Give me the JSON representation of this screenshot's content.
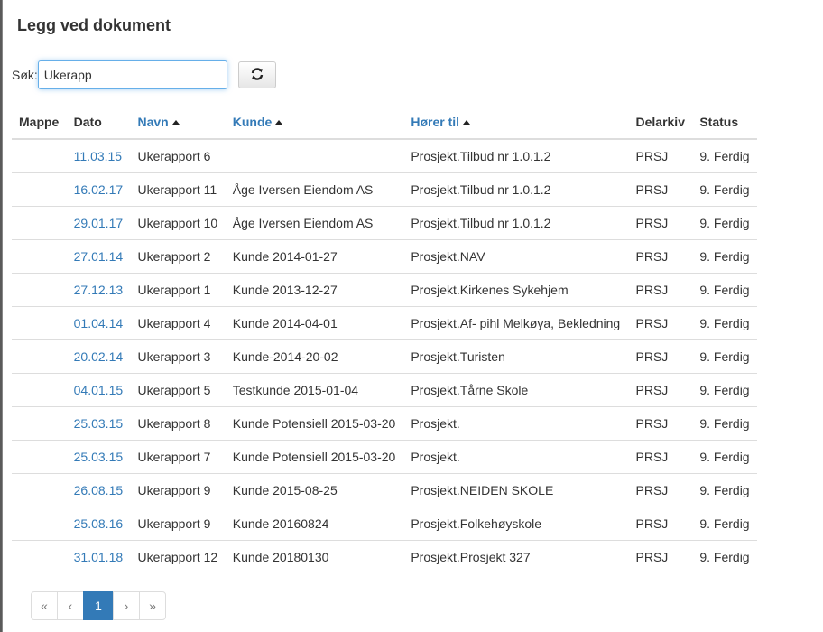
{
  "modal": {
    "title": "Legg ved dokument"
  },
  "search": {
    "label": "Søk:",
    "value": "Ukerapp"
  },
  "refresh": {
    "icon": "refresh-icon"
  },
  "table": {
    "headers": {
      "mappe": "Mappe",
      "dato": "Dato",
      "navn": "Navn",
      "kunde": "Kunde",
      "horer_til": "Hører til",
      "delarkiv": "Delarkiv",
      "status": "Status"
    },
    "rows": [
      {
        "dato": "11.03.15",
        "navn": "Ukerapport 6",
        "kunde": "",
        "horer_til": "Prosjekt.Tilbud nr 1.0.1.2",
        "delarkiv": "PRSJ",
        "status": "9. Ferdig"
      },
      {
        "dato": "16.02.17",
        "navn": "Ukerapport 11",
        "kunde": "Åge Iversen Eiendom AS",
        "horer_til": "Prosjekt.Tilbud nr 1.0.1.2",
        "delarkiv": "PRSJ",
        "status": "9. Ferdig"
      },
      {
        "dato": "29.01.17",
        "navn": "Ukerapport 10",
        "kunde": "Åge Iversen Eiendom AS",
        "horer_til": "Prosjekt.Tilbud nr 1.0.1.2",
        "delarkiv": "PRSJ",
        "status": "9. Ferdig"
      },
      {
        "dato": "27.01.14",
        "navn": "Ukerapport 2",
        "kunde": "Kunde 2014-01-27",
        "horer_til": "Prosjekt.NAV",
        "delarkiv": "PRSJ",
        "status": "9. Ferdig"
      },
      {
        "dato": "27.12.13",
        "navn": "Ukerapport 1",
        "kunde": "Kunde 2013-12-27",
        "horer_til": "Prosjekt.Kirkenes Sykehjem",
        "delarkiv": "PRSJ",
        "status": "9. Ferdig"
      },
      {
        "dato": "01.04.14",
        "navn": "Ukerapport 4",
        "kunde": "Kunde 2014-04-01",
        "horer_til": "Prosjekt.Af- pihl Melkøya, Bekledning",
        "delarkiv": "PRSJ",
        "status": "9. Ferdig"
      },
      {
        "dato": "20.02.14",
        "navn": "Ukerapport 3",
        "kunde": "Kunde-2014-20-02",
        "horer_til": "Prosjekt.Turisten",
        "delarkiv": "PRSJ",
        "status": "9. Ferdig"
      },
      {
        "dato": "04.01.15",
        "navn": "Ukerapport 5",
        "kunde": "Testkunde 2015-01-04",
        "horer_til": "Prosjekt.Tårne Skole",
        "delarkiv": "PRSJ",
        "status": "9. Ferdig"
      },
      {
        "dato": "25.03.15",
        "navn": "Ukerapport 8",
        "kunde": "Kunde Potensiell 2015-03-20",
        "horer_til": "Prosjekt.",
        "delarkiv": "PRSJ",
        "status": "9. Ferdig"
      },
      {
        "dato": "25.03.15",
        "navn": "Ukerapport 7",
        "kunde": "Kunde Potensiell 2015-03-20",
        "horer_til": "Prosjekt.",
        "delarkiv": "PRSJ",
        "status": "9. Ferdig"
      },
      {
        "dato": "26.08.15",
        "navn": "Ukerapport 9",
        "kunde": "Kunde 2015-08-25",
        "horer_til": "Prosjekt.NEIDEN SKOLE",
        "delarkiv": "PRSJ",
        "status": "9. Ferdig"
      },
      {
        "dato": "25.08.16",
        "navn": "Ukerapport 9",
        "kunde": "Kunde 20160824",
        "horer_til": "Prosjekt.Folkehøyskole",
        "delarkiv": "PRSJ",
        "status": "9. Ferdig"
      },
      {
        "dato": "31.01.18",
        "navn": "Ukerapport 12",
        "kunde": "Kunde 20180130",
        "horer_til": "Prosjekt.Prosjekt 327",
        "delarkiv": "PRSJ",
        "status": "9. Ferdig"
      }
    ]
  },
  "pagination": {
    "first": "«",
    "prev": "‹",
    "current": "1",
    "next": "›",
    "last": "»"
  },
  "colors": {
    "link": "#337ab7",
    "active_page": "#337ab7"
  }
}
